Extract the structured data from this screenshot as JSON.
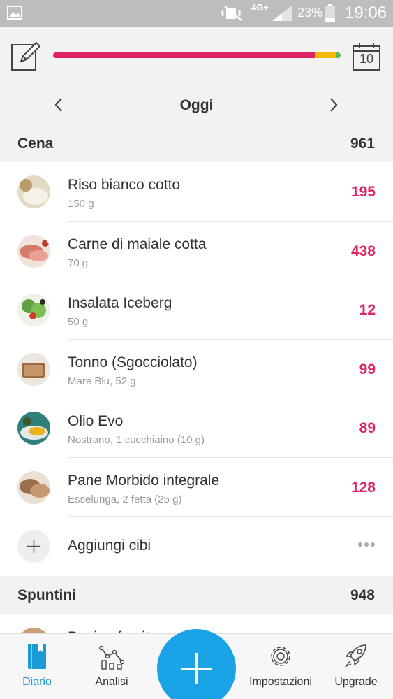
{
  "status_bar": {
    "network": "4G+",
    "battery_pct": "23%",
    "time": "19:06"
  },
  "header": {
    "progress": {
      "consumed_fraction": 0.91,
      "warning_fraction": 0.075,
      "colors": {
        "consumed": "#e0225f",
        "warning": "#f5b800",
        "extra": "#5cb85c",
        "track": "#e0e0e0"
      }
    },
    "calendar_day": "10",
    "date_label": "Oggi"
  },
  "sections": [
    {
      "name": "Cena",
      "total": "961",
      "items": [
        {
          "title": "Riso bianco cotto",
          "subtitle": "150 g",
          "kcal": "195",
          "thumb_color": "#d8cbb0"
        },
        {
          "title": "Carne di maiale cotta",
          "subtitle": "70 g",
          "kcal": "438",
          "thumb_color": "#d98a7a"
        },
        {
          "title": "Insalata Iceberg",
          "subtitle": "50 g",
          "kcal": "12",
          "thumb_color": "#6aa84f"
        },
        {
          "title": "Tonno (Sgocciolato)",
          "subtitle": "Mare Blu, 52 g",
          "kcal": "99",
          "thumb_color": "#b5835a"
        },
        {
          "title": "Olio Evo",
          "subtitle": "Nostrano, 1 cucchiaino (10 g)",
          "kcal": "89",
          "thumb_color": "#e3b23c"
        },
        {
          "title": "Pane Morbido integrale",
          "subtitle": "Esselunga, 2 fetta (25 g)",
          "kcal": "128",
          "thumb_color": "#a0785a"
        }
      ],
      "add_label": "Aggiungi cibi"
    },
    {
      "name": "Spuntini",
      "total": "948",
      "peek_title": "Panino farcito con ..."
    }
  ],
  "bottom_nav": {
    "tabs": [
      {
        "label": "Diario",
        "icon": "diary-icon",
        "active": true
      },
      {
        "label": "Analisi",
        "icon": "analytics-icon",
        "active": false
      },
      {
        "label": "Impostazioni",
        "icon": "settings-gear-icon",
        "active": false
      },
      {
        "label": "Upgrade",
        "icon": "rocket-icon",
        "active": false
      }
    ],
    "fab_icon": "plus-icon",
    "accent": "#1aa3e6"
  }
}
